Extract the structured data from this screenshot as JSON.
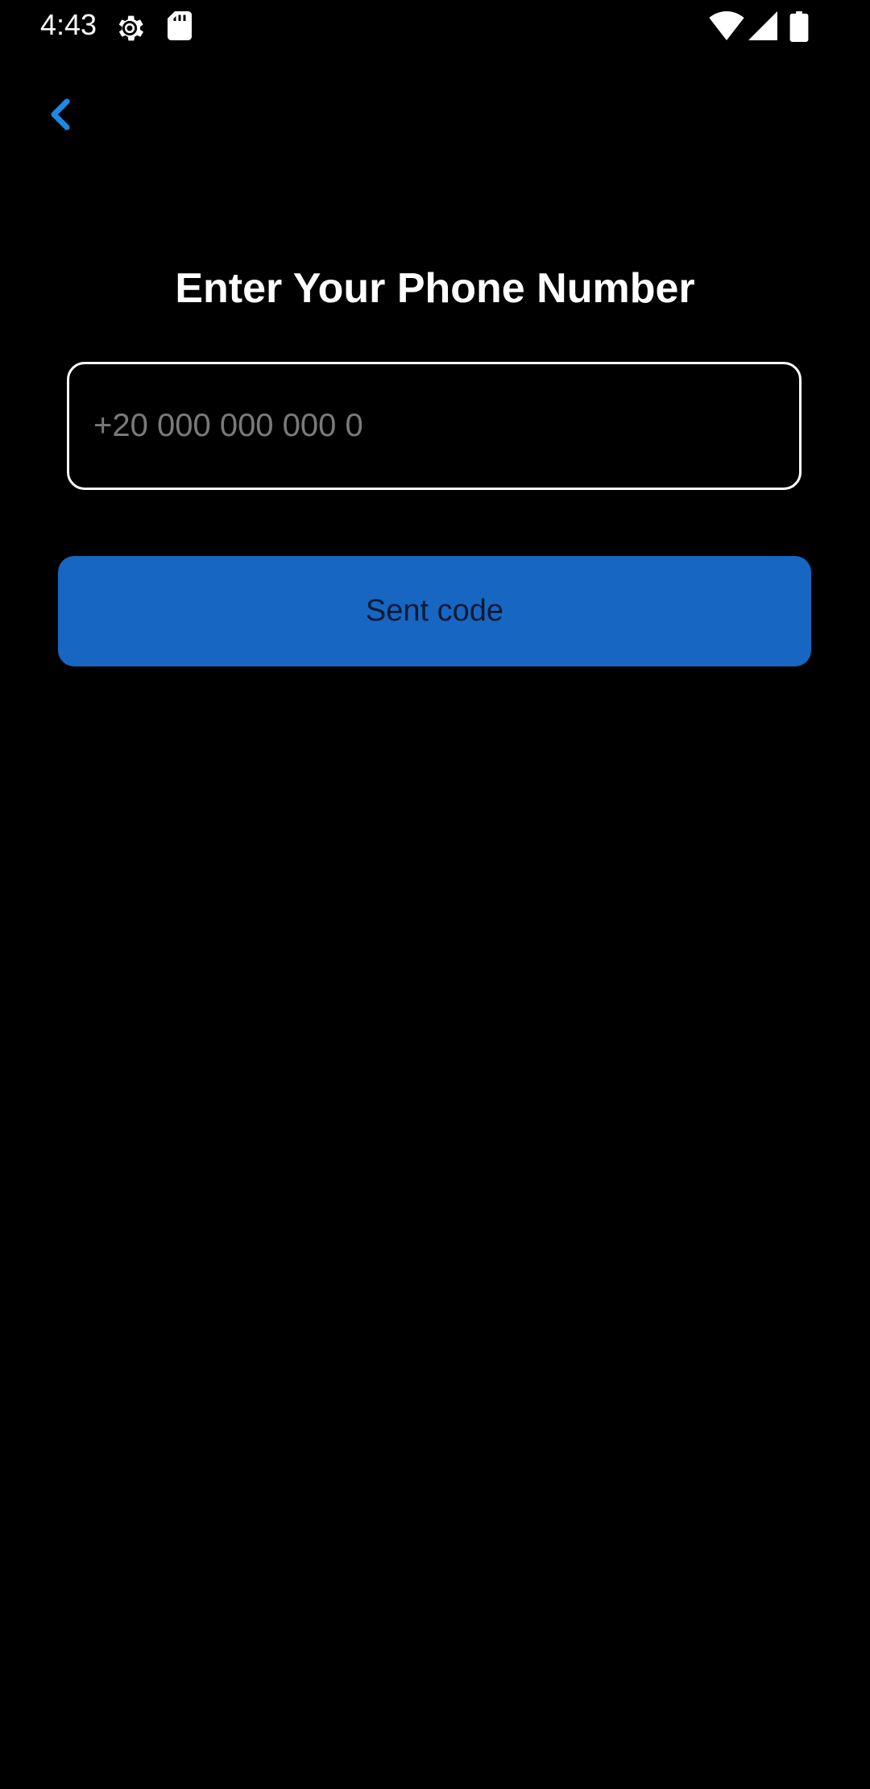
{
  "status_bar": {
    "time": "4:43",
    "icons": [
      "gear-icon",
      "sd-card-icon",
      "wifi-icon",
      "signal-icon",
      "battery-icon"
    ]
  },
  "nav": {
    "back_icon": "chevron-left-icon"
  },
  "main": {
    "title": "Enter Your Phone Number",
    "phone_input": {
      "placeholder": "+20 000 000 000 0",
      "value": ""
    },
    "send_button_label": "Sent code"
  },
  "colors": {
    "background": "#000000",
    "accent": "#1766c2",
    "back_icon": "#1e88e5",
    "placeholder": "#7a7a7a"
  }
}
